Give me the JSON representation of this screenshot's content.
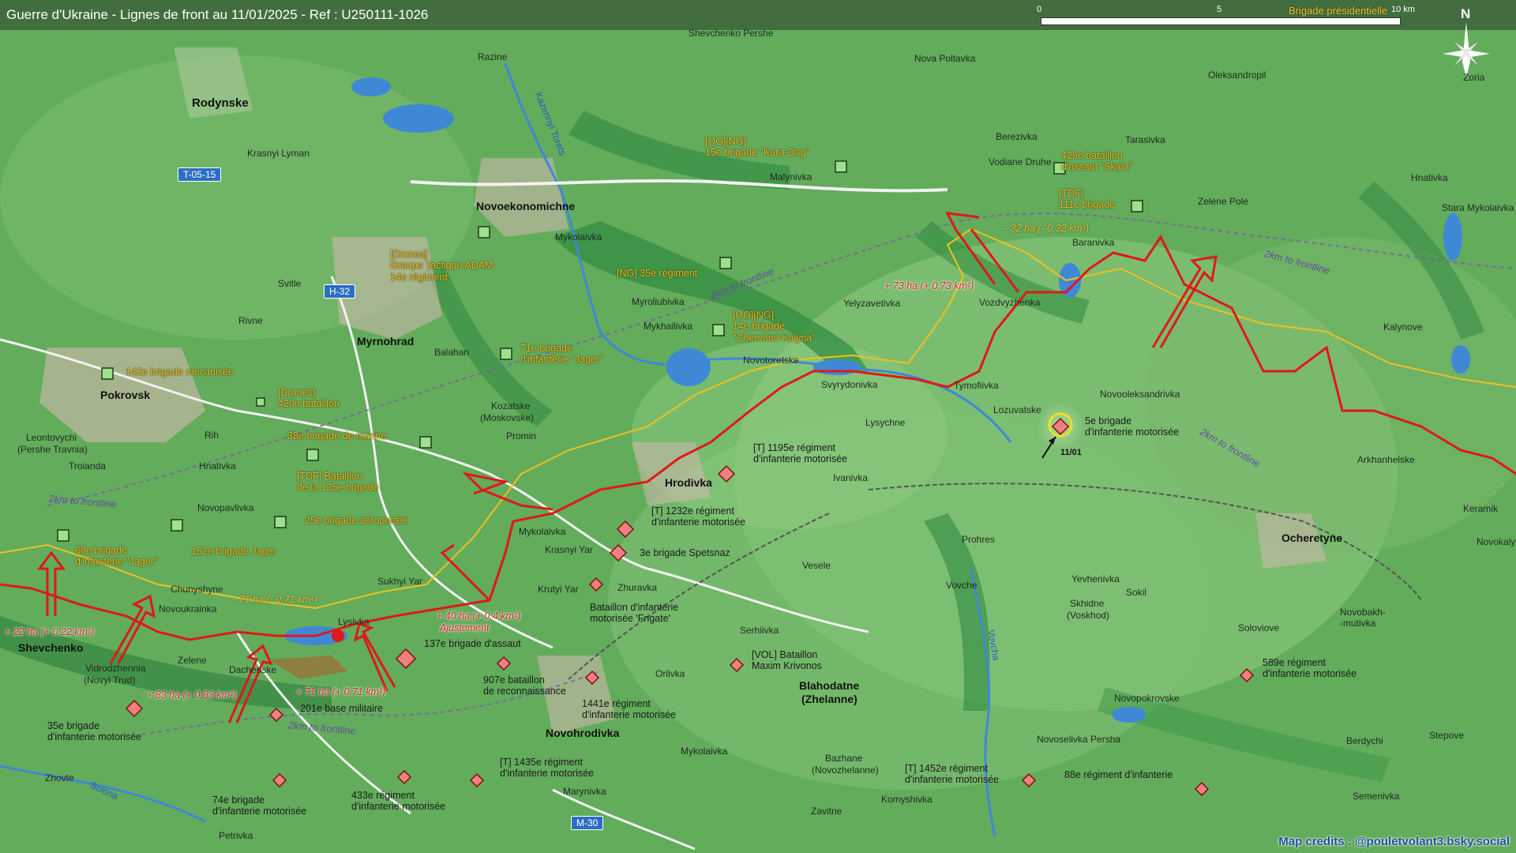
{
  "title": "Guerre d'Ukraine - Lignes de front au 11/01/2025 - Ref : U250111-1026",
  "scale": {
    "ticks": [
      "0",
      "5",
      "10 km"
    ]
  },
  "compass_letter": "N",
  "credits": "Map credits : @pouletvolant3.bsky.social",
  "top_right_unit": "Brigade présidentielle",
  "colors": {
    "front": "#e01818",
    "old_front": "#f0c020",
    "forest": "#3f9b45",
    "water": "#3f88d6"
  },
  "road_shields": [
    "T-05-15",
    "H-32",
    "M-30"
  ],
  "places": {
    "rodynske": "Rodynske",
    "krasnyi_lyman": "Krasnyi Lyman",
    "razine": "Razine",
    "shevchenko_pershe": "Shevchenko Pershe",
    "nova_poltavka": "Nova Poltavka",
    "oleksandropil": "Oleksandropil",
    "zoria": "Zoria",
    "berezivka": "Berezivka",
    "tarasivka": "Tarasivka",
    "vodiane_druhe": "Vodiane Druhe",
    "malynivka": "Malynivka",
    "hnativka_ne": "Hnativka",
    "stara_mykolaivka": "Stara Mykolaivka",
    "zelene_pole": "Zelene Pole",
    "novoekonomichne": "Novoekonomichne",
    "kazennyi_torets": "Kazennyi Torets",
    "mykolaivka_n": "Mykolaivka",
    "baranivka": "Baranivka",
    "svitle": "Svitle",
    "rivne": "Rivne",
    "myrnohrad": "Myrnohrad",
    "balahan": "Balahan",
    "myroliubivka": "Myroliubivka",
    "mykhailivka": "Mykhailivka",
    "yelyzavetivka": "Yelyzavetivka",
    "vozdvyzhenka": "Vozdvyzhenka",
    "kalynove": "Kalynove",
    "pokrovsk": "Pokrovsk",
    "novotoretske": "Novotoretske",
    "svyrydonivka": "Svyrydonivka",
    "tymofiivka": "Tymofiivka",
    "novooleksandrivka": "Novooleksandrivka",
    "kozatske": "Kozatske",
    "moskovske": "(Moskovske)",
    "lozuvatske": "Lozuvatske",
    "lysychne": "Lysychne",
    "leontovychi": "Leontovychi",
    "pershe_travnia": "(Pershe Travnia)",
    "rih": "Rih",
    "promin": "Promin",
    "troianda": "Troianda",
    "hnativka_w": "Hnativka",
    "arkhanhelske": "Arkhanhelske",
    "hrodivka": "Hrodivka",
    "ivanivka": "Ivanivka",
    "novopavlivka": "Novopavlivka",
    "keramik": "Keramik",
    "mykolaivka_c": "Mykolaivka",
    "krasnyi_yar": "Krasnyi Yar",
    "prohres": "Prohres",
    "ocheretyne": "Ocheretyne",
    "novokalynove": "Novokalynove",
    "vesele": "Vesele",
    "chunyshyne": "Chunyshyne",
    "sukhyi_yar": "Sukhyi Yar",
    "krutyi_yar": "Krutyi Yar",
    "zhuravka": "Zhuravka",
    "vovche": "Vovche",
    "yevhenivka": "Yevhenivka",
    "sokil": "Sokil",
    "novoukrainka": "Novoukrainka",
    "skhidne": "Skhidne",
    "voskhod": "(Voskhod)",
    "soloviove": "Soloviove",
    "novobakhmutivka": "Novobakh-\n-mutivka",
    "lysivka": "Lysivka",
    "shevchenko": "Shevchenko",
    "serhiivka": "Serhiivka",
    "zelene": "Zelene",
    "vidrodzhennia": "Vidrodzhennia",
    "novyi_trud": "(Novyi Trud)",
    "dachenske": "Dachenske",
    "orlivka": "Orlivka",
    "blahodatne": "Blahodatne",
    "zhelanne": "(Zhelanne)",
    "novopokrovske": "Novopokrovske",
    "novohrodivka": "Novohrodivka",
    "novoselivka_persha": "Novoselivka Persha",
    "berdychi": "Berdychi",
    "stepove": "Stepove",
    "mykolaivka_s": "Mykolaivka",
    "bazhane": "Bazhane",
    "novozhelanne": "(Novozhelanne)",
    "zhovte": "Zhovte",
    "solona": "Solona",
    "marynivka": "Marynivka",
    "komyshivka": "Komyshivka",
    "semenivka": "Semenivka",
    "zavitne": "Zavitne",
    "petrivka": "Petrivka",
    "vovcha": "Vovcha"
  },
  "ua_units": {
    "kara_dag": "[OG][NG]\n15e brigade \"Kara-Dag\"",
    "skala": "425e bataillon\nd'assaut \"Skala\"",
    "tdf111": "[TDF]\n111e brigade",
    "adam": "[Drones]\nGroupe Tactique ADAM\n14e régiment",
    "ng35": "[NG] 35e régiment",
    "chervona": "[OG][NG]\n14e brigade\n\"Chervona Kalyna\"",
    "jager71": "71e brigade\nd'infanterie \"Jager\"",
    "meca142": "142e brigade mécanisée",
    "drones420": "[Drones]\n420e bataillon",
    "marine38": "38e brigade de marine",
    "tdf125": "[TDF] Bataillon\nde la 125e brigade",
    "aero25": "25e brigade aéroportée",
    "jager68": "68e brigade\nd'infanterie \"Jager\"",
    "jager152": "152e brigade Jager"
  },
  "ru_units": {
    "moto5": "5e brigade\nd'infanterie motorisée",
    "reg1195": "[T] 1195e régiment\nd'infanterie motorisée",
    "reg1232": "[T] 1232e régiment\nd'infanterie motorisée",
    "spetsnaz3": "3e brigade Spetsnaz",
    "frigate": "Bataillon d'infanterie\nmotorisée 'Frigate'",
    "assaut137": "137e brigade d'assaut",
    "recon907": "907e bataillon\nde reconnaissance",
    "reg1441": "1441e régiment\nd'infanterie motorisée",
    "krivonos": "[VOL] Bataillon\nMaxim Krivonos",
    "reg589": "589e régiment\nd'infanterie motorisée",
    "moto35": "35e brigade\nd'infanterie motorisée",
    "base201": "201e base militaire",
    "reg1435": "[T] 1435e régiment\nd'infanterie motorisée",
    "reg433": "433e régiment\nd'infanterie motorisée",
    "moto74": "74e brigade\nd'infanterie motorisée",
    "reg1452": "[T] 1452e régiment\nd'infanterie motorisée",
    "reg88": "88e régiment d'infanterie"
  },
  "changes": {
    "g73": "+ 73 ha (+ 0.73 km²)",
    "l32": "- 32 ha (- 0.32 km²)",
    "l71": "- 71 ha (- 0.71 km²)",
    "g40": "+ 40 ha (+ 0.4 km²)",
    "ajust": "Ajustement",
    "g22": "+ 22 ha (+ 0.22 km²)",
    "g83": "+ 83 ha (+ 0.83 km²)",
    "g71": "+ 71 ha (+ 0.71 km²)"
  },
  "frontline_labels": [
    "2km to frontline",
    "2km to frontline",
    "2km to frontline",
    "2km to frontline",
    "2km to frontline"
  ],
  "date_tag": "11/01"
}
